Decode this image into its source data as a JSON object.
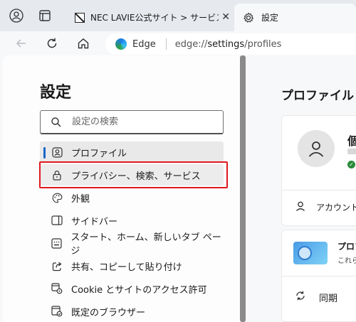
{
  "browser": {
    "tabs": [
      {
        "title": "NEC LAVIE公式サイト > サービス&サポート",
        "active": false
      },
      {
        "title": "設定",
        "active": true
      }
    ],
    "close_glyph": "✕",
    "address": {
      "brand": "Edge",
      "url_prefix": "edge://",
      "url_bold": "settings",
      "url_suffix": "/profiles"
    }
  },
  "settings": {
    "title": "設定",
    "search_placeholder": "設定の検索",
    "menu": [
      {
        "label": "プロファイル",
        "icon": "profile-icon"
      },
      {
        "label": "プライバシー、検索、サービス",
        "icon": "lock-icon"
      },
      {
        "label": "外観",
        "icon": "palette-icon"
      },
      {
        "label": "サイドバー",
        "icon": "sidebar-icon"
      },
      {
        "label": "スタート、ホーム、新しいタブ ページ",
        "icon": "home-icon"
      },
      {
        "label": "共有、コピーして貼り付け",
        "icon": "share-icon"
      },
      {
        "label": "Cookie とサイトのアクセス許可",
        "icon": "cookie-icon"
      },
      {
        "label": "既定のブラウザー",
        "icon": "browser-icon"
      }
    ]
  },
  "profile_pane": {
    "title": "プロファイル",
    "name_partial": "個",
    "account_label": "アカウント",
    "promo_title": "プロフ",
    "promo_subtitle": "これら",
    "sync_label": "同期"
  },
  "colors": {
    "highlight": "#e0191f",
    "accent": "#1a65c8"
  }
}
